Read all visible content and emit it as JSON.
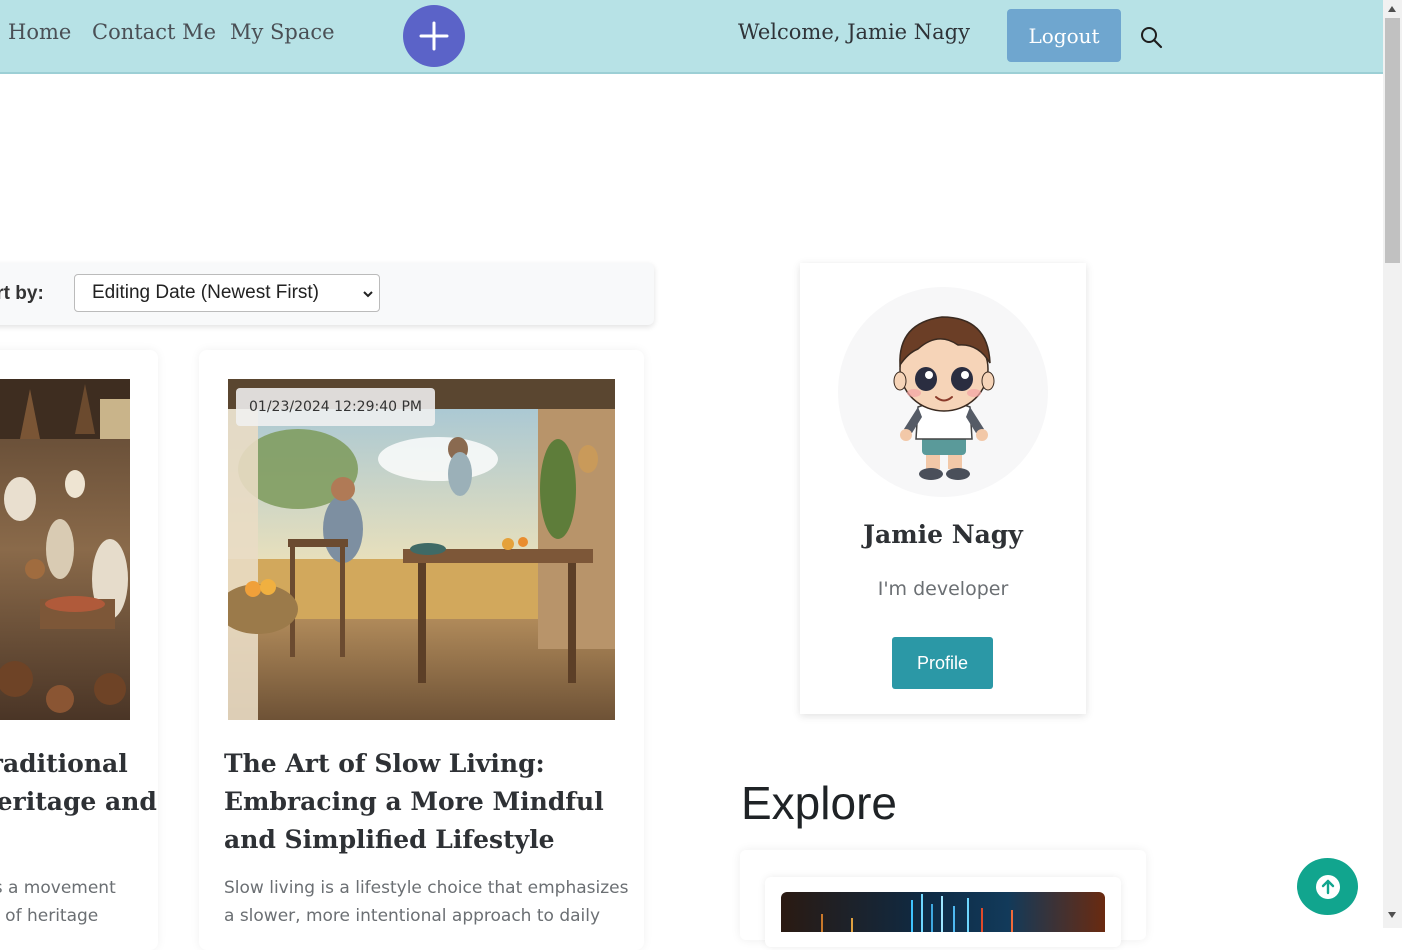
{
  "nav": {
    "links": [
      "Home",
      "Contact Me",
      "My Space"
    ],
    "welcome": "Welcome,  Jamie Nagy",
    "logout_label": "Logout"
  },
  "sort": {
    "label": "Sort by:",
    "selected": "Editing Date (Newest First)"
  },
  "posts": [
    {
      "title_lines": [
        "Traditional",
        "Heritage and"
      ],
      "desc_lines": [
        "is a movement",
        "n of heritage"
      ]
    },
    {
      "date": "01/23/2024 12:29:40 PM",
      "title_lines": [
        "The Art of Slow Living:",
        "Embracing a More Mindful",
        "and Simplified Lifestyle"
      ],
      "desc_lines": [
        "Slow living is a lifestyle choice that emphasizes",
        "a slower, more intentional approach to daily"
      ]
    }
  ],
  "profile": {
    "name": "Jamie Nagy",
    "bio": "I'm developer",
    "button_label": "Profile"
  },
  "explore": {
    "title": "Explore"
  },
  "colors": {
    "navbar": "#b7e2e6",
    "add_button": "#5b63c8",
    "logout": "#6fa6cf",
    "profile_button": "#2b98a6",
    "to_top": "#11a58e"
  },
  "icons": {
    "add": "plus-icon",
    "search": "search-icon",
    "select": "chevron-down-icon",
    "to_top": "arrow-up-icon"
  }
}
